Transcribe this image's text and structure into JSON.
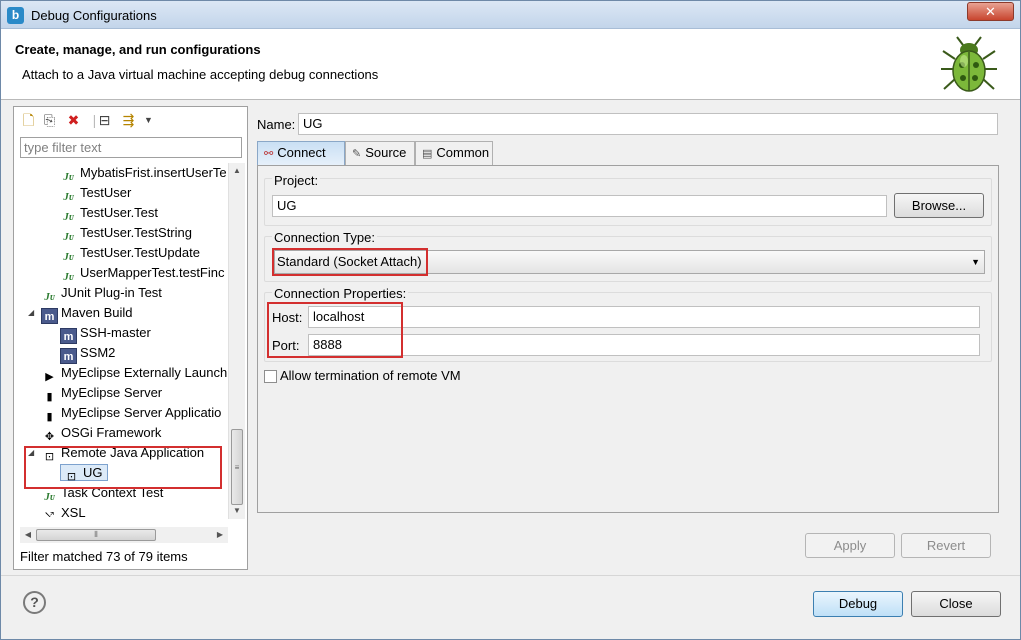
{
  "window": {
    "title": "Debug Configurations",
    "close_symbol": "✕"
  },
  "banner": {
    "title": "Create, manage, and run configurations",
    "subtitle": "Attach to a Java virtual machine accepting debug connections"
  },
  "left": {
    "filter_placeholder": "type filter text",
    "tree": [
      {
        "label": "MybatisFrist.insertUserTe",
        "icon": "junit-icon",
        "level": 2
      },
      {
        "label": "TestUser",
        "icon": "junit-icon",
        "level": 2
      },
      {
        "label": "TestUser.Test",
        "icon": "junit-icon",
        "level": 2
      },
      {
        "label": "TestUser.TestString",
        "icon": "junit-icon",
        "level": 2
      },
      {
        "label": "TestUser.TestUpdate",
        "icon": "junit-icon",
        "level": 2
      },
      {
        "label": "UserMapperTest.testFinc",
        "icon": "junit-icon",
        "level": 2
      },
      {
        "label": "JUnit Plug-in Test",
        "icon": "junit-plugin-icon",
        "level": 1
      },
      {
        "label": "Maven Build",
        "icon": "maven-icon",
        "level": 1,
        "expanded": true
      },
      {
        "label": "SSH-master",
        "icon": "maven-icon",
        "level": 2
      },
      {
        "label": "SSM2",
        "icon": "maven-icon",
        "level": 2
      },
      {
        "label": "MyEclipse Externally Launch",
        "icon": "external-launch-icon",
        "level": 1
      },
      {
        "label": "MyEclipse Server",
        "icon": "server-icon",
        "level": 1
      },
      {
        "label": "MyEclipse Server Applicatio",
        "icon": "server-app-icon",
        "level": 1
      },
      {
        "label": "OSGi Framework",
        "icon": "osgi-icon",
        "level": 1
      },
      {
        "label": "Remote Java Application",
        "icon": "remote-java-icon",
        "level": 1,
        "expanded": true
      },
      {
        "label": "UG",
        "icon": "remote-java-icon",
        "level": 2,
        "selected": true
      },
      {
        "label": "Task Context Test",
        "icon": "task-icon",
        "level": 1
      },
      {
        "label": "XSL",
        "icon": "xsl-icon",
        "level": 1
      }
    ],
    "status": "Filter matched 73 of 79 items"
  },
  "right": {
    "name_label": "Name:",
    "name_value": "UG",
    "tabs": [
      {
        "label": "Connect",
        "icon": "connect-icon",
        "active": true
      },
      {
        "label": "Source",
        "icon": "source-icon",
        "active": false
      },
      {
        "label": "Common",
        "icon": "common-icon",
        "active": false
      }
    ],
    "project_label": "Project:",
    "project_value": "UG",
    "browse_label": "Browse...",
    "conn_type_label": "Connection Type:",
    "conn_type_value": "Standard (Socket Attach)",
    "conn_props_label": "Connection Properties:",
    "host_label": "Host:",
    "host_value": "localhost",
    "port_label": "Port:",
    "port_value": "8888",
    "allow_term_label": "Allow termination of remote VM",
    "allow_term_checked": false,
    "apply_label": "Apply",
    "revert_label": "Revert"
  },
  "footer": {
    "help_symbol": "?",
    "debug_label": "Debug",
    "close_label": "Close"
  },
  "colors": {
    "highlight": "#d32f2f",
    "selection": "#dceaf8"
  }
}
